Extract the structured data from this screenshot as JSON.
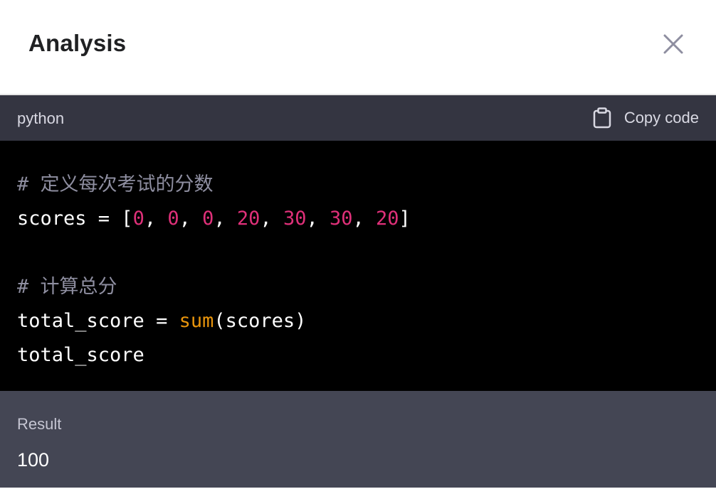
{
  "modal": {
    "title": "Analysis",
    "close_icon": "close-icon"
  },
  "code_block": {
    "language": "python",
    "copy_label": "Copy code",
    "copy_icon": "clipboard-icon",
    "lines": {
      "l1": {
        "comment": "# 定义每次考试的分数"
      },
      "l2": {
        "p0": "scores = [",
        "n0": "0",
        "s0": ", ",
        "n1": "0",
        "s1": ", ",
        "n2": "0",
        "s2": ", ",
        "n3": "20",
        "s3": ", ",
        "n4": "30",
        "s4": ", ",
        "n5": "30",
        "s5": ", ",
        "n6": "20",
        "end": "]"
      },
      "l4": {
        "comment": "# 计算总分"
      },
      "l5": {
        "p0": "total_score = ",
        "fn": "sum",
        "p1": "(scores)"
      },
      "l6": {
        "p0": "total_score"
      }
    }
  },
  "result": {
    "label": "Result",
    "value": "100"
  },
  "colors": {
    "code_header_bg": "#343541",
    "code_bg": "#000000",
    "result_bg": "#444654",
    "number": "#df3079",
    "builtin": "#e9950c",
    "comment": "#8e8ea0"
  }
}
